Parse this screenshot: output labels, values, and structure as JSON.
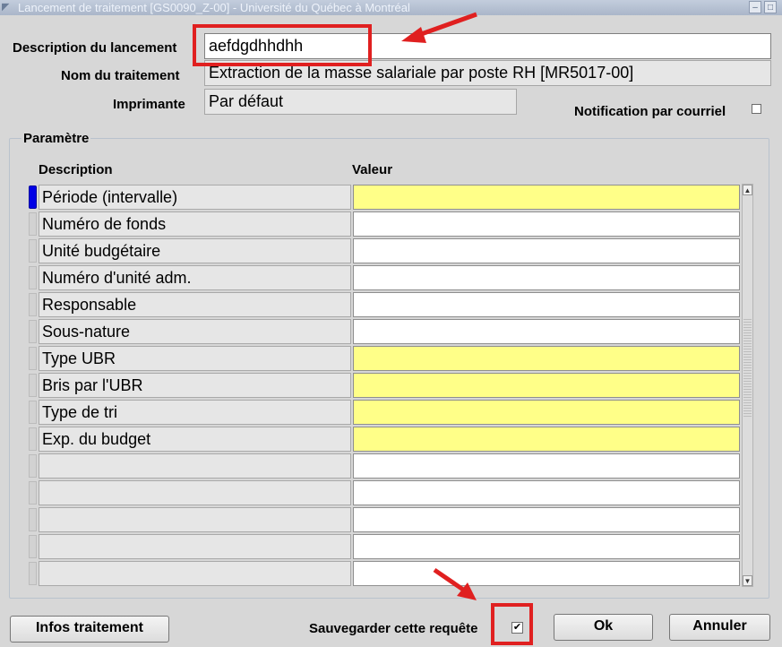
{
  "window": {
    "title": "Lancement de traitement [GS0090_Z-00] - Université du Québec à Montréal",
    "icon": "window-app-icon",
    "minimize_glyph": "–",
    "maximize_glyph": "□"
  },
  "form": {
    "description_label": "Description du lancement",
    "description_value": "aefdgdhhdhh",
    "nom_label": "Nom du traitement",
    "nom_value": "Extraction de la masse salariale par poste RH [MR5017-00]",
    "imprimante_label": "Imprimante",
    "imprimante_value": "Par défaut",
    "notification_label": "Notification par courriel",
    "notification_checked": false
  },
  "parametre": {
    "legend": "Paramètre",
    "col_description": "Description",
    "col_valeur": "Valeur",
    "rows": [
      {
        "description": "Période (intervalle)",
        "value": "",
        "required": true
      },
      {
        "description": "Numéro de fonds",
        "value": "",
        "required": false
      },
      {
        "description": "Unité budgétaire",
        "value": "",
        "required": false
      },
      {
        "description": "Numéro d'unité adm.",
        "value": "",
        "required": false
      },
      {
        "description": "Responsable",
        "value": "",
        "required": false
      },
      {
        "description": "Sous-nature",
        "value": "",
        "required": false
      },
      {
        "description": "Type UBR",
        "value": "",
        "required": true
      },
      {
        "description": "Bris par l'UBR",
        "value": "",
        "required": true
      },
      {
        "description": "Type de tri",
        "value": "",
        "required": true
      },
      {
        "description": "Exp. du budget",
        "value": "",
        "required": true
      },
      {
        "description": "",
        "value": "",
        "required": false
      },
      {
        "description": "",
        "value": "",
        "required": false
      },
      {
        "description": "",
        "value": "",
        "required": false
      },
      {
        "description": "",
        "value": "",
        "required": false
      },
      {
        "description": "",
        "value": "",
        "required": false
      }
    ],
    "scroll_up_glyph": "▲",
    "scroll_down_glyph": "▼"
  },
  "footer": {
    "infos_button": "Infos traitement",
    "sauvegarder_label": "Sauvegarder cette requête",
    "sauvegarder_checked": true,
    "check_glyph": "✔",
    "ok_button": "Ok",
    "annuler_button": "Annuler"
  },
  "colors": {
    "required_field": "#ffff88",
    "annotation": "#e02020",
    "current_row_marker": "#0000e6"
  }
}
